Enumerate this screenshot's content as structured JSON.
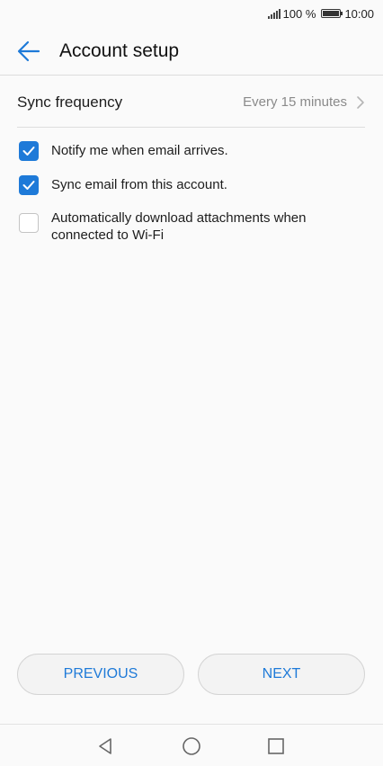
{
  "status_bar": {
    "battery_percent": "100 %",
    "battery_level": 1.0,
    "time": "10:00",
    "icons": [
      "signal-icon",
      "battery-icon"
    ]
  },
  "app_bar": {
    "title": "Account setup",
    "back_icon": "arrow-left-icon"
  },
  "sync_frequency": {
    "label": "Sync frequency",
    "value": "Every 15 minutes",
    "icon": "chevron-right-icon"
  },
  "options": [
    {
      "label": "Notify me when email arrives.",
      "checked": true
    },
    {
      "label": "Sync email from this account.",
      "checked": true
    },
    {
      "label": "Automatically download attachments when connected to Wi-Fi",
      "checked": false
    }
  ],
  "buttons": {
    "previous": "PREVIOUS",
    "next": "NEXT"
  },
  "colors": {
    "accent": "#1e7ad8",
    "background": "#fafafa"
  },
  "nav_bar": {
    "icons": [
      "back-triangle-icon",
      "home-circle-icon",
      "recents-square-icon"
    ]
  }
}
